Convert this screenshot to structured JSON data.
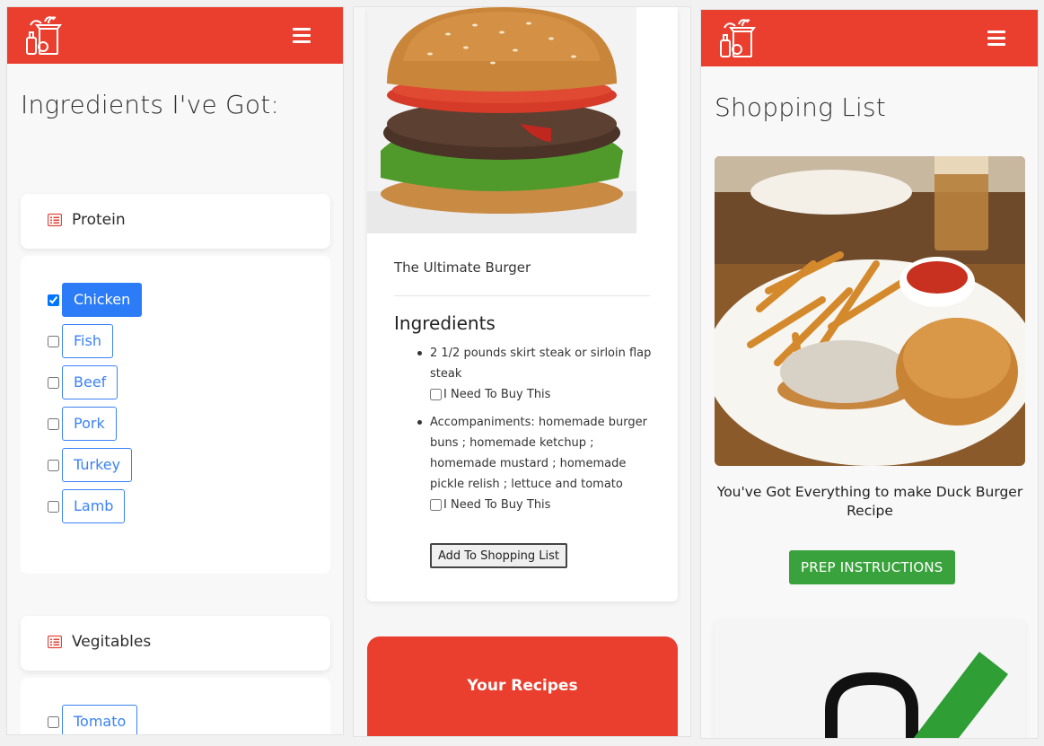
{
  "left": {
    "heading": "Ingredients I've Got:",
    "categories": [
      {
        "label": "Protein",
        "icon": "list-icon"
      },
      {
        "label": "Vegitables",
        "icon": "list-icon"
      }
    ],
    "protein_options": [
      {
        "label": "Chicken",
        "checked": true
      },
      {
        "label": "Fish",
        "checked": false
      },
      {
        "label": "Beef",
        "checked": false
      },
      {
        "label": "Pork",
        "checked": false
      },
      {
        "label": "Turkey",
        "checked": false
      },
      {
        "label": "Lamb",
        "checked": false
      }
    ],
    "veg_options": [
      {
        "label": "Tomato",
        "checked": false
      }
    ]
  },
  "middle": {
    "recipe_title": "The Ultimate Burger",
    "ingredients_heading": "Ingredients",
    "ingredients": [
      {
        "text": "2 1/2 pounds skirt steak or sirloin flap steak",
        "buy_label": "I Need To Buy This"
      },
      {
        "text": "Accompaniments: homemade burger buns ; homemade ketchup ; homemade mustard ; homemade pickle relish ; lettuce and tomato",
        "buy_label": "I Need To Buy This"
      }
    ],
    "add_button": "Add To Shopping List",
    "your_recipes": "Your Recipes"
  },
  "right": {
    "heading": "Shopping List",
    "everything_text": "You've Got Everything to make Duck Burger Recipe",
    "prep_button": "PREP INSTRUCTIONS"
  },
  "colors": {
    "brand_red": "#ea3f2f",
    "blue": "#2b7cf6",
    "green": "#3aa23d"
  }
}
